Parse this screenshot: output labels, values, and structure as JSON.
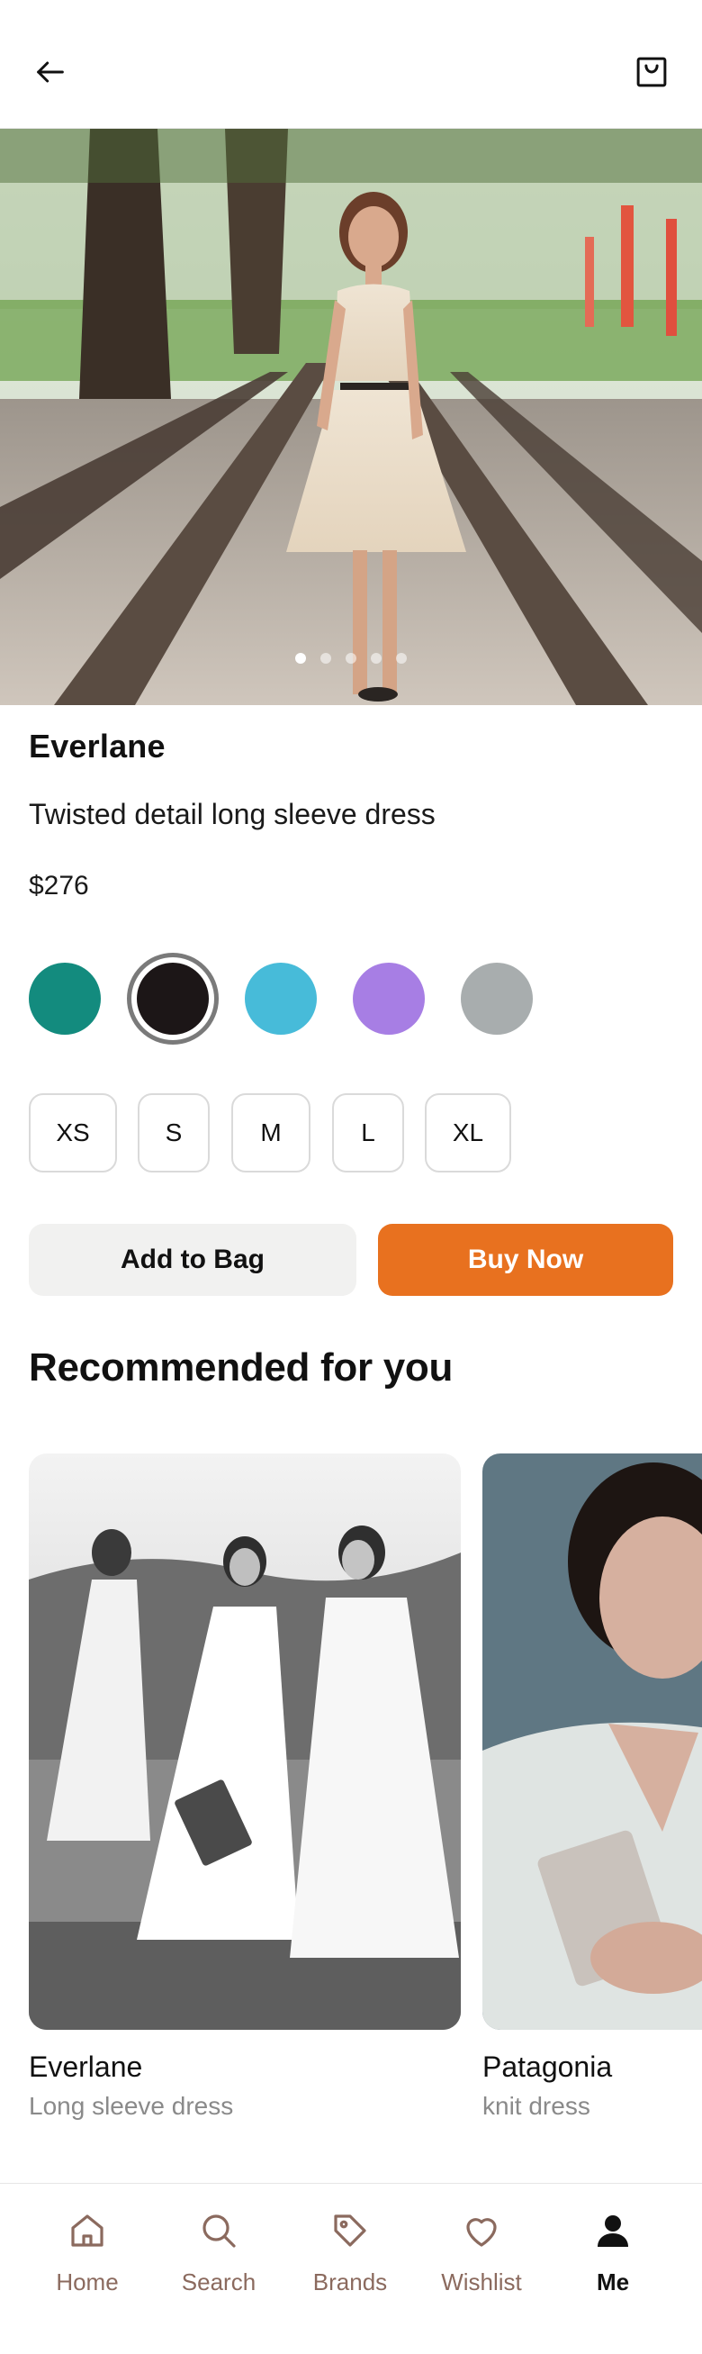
{
  "header": {
    "back_icon": "arrow-left-icon",
    "bag_icon": "shopping-bag-icon"
  },
  "gallery": {
    "image_count": 5,
    "active_index": 0
  },
  "product": {
    "brand": "Everlane",
    "name": "Twisted detail long sleeve dress",
    "price": "$276"
  },
  "colors": [
    {
      "name": "teal",
      "hex": "#138b7e"
    },
    {
      "name": "black",
      "hex": "#1c1617",
      "selected": true
    },
    {
      "name": "sky blue",
      "hex": "#47bbd9"
    },
    {
      "name": "lavender",
      "hex": "#a77ee4"
    },
    {
      "name": "gray",
      "hex": "#a8adae"
    }
  ],
  "sizes": [
    "XS",
    "S",
    "M",
    "L",
    "XL"
  ],
  "actions": {
    "add_to_bag": "Add to Bag",
    "buy_now": "Buy Now"
  },
  "accent": "#e8711f",
  "recommended": {
    "title": "Recommended for you",
    "items": [
      {
        "brand": "Everlane",
        "subtitle": "Long sleeve dress"
      },
      {
        "brand": "Patagonia",
        "subtitle": "knit dress"
      }
    ]
  },
  "tabbar": {
    "items": [
      {
        "label": "Home",
        "icon": "home-icon"
      },
      {
        "label": "Search",
        "icon": "search-icon"
      },
      {
        "label": "Brands",
        "icon": "tag-icon"
      },
      {
        "label": "Wishlist",
        "icon": "heart-icon"
      },
      {
        "label": "Me",
        "icon": "user-icon",
        "active": true
      }
    ]
  }
}
